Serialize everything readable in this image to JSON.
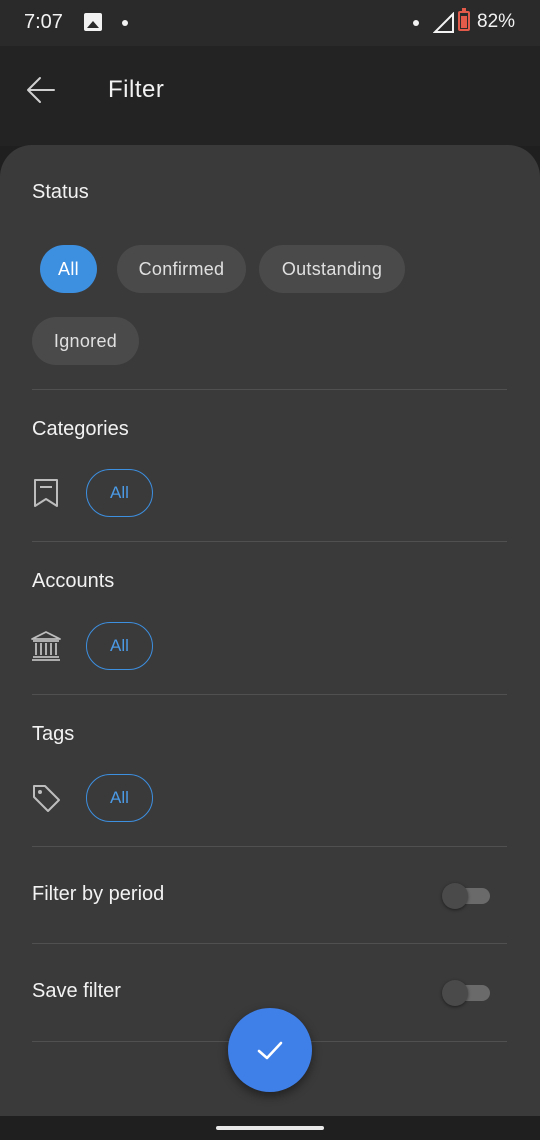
{
  "status_bar": {
    "time": "7:07",
    "battery_percent": "82%",
    "battery_level": 0.82,
    "icons": [
      "image-icon",
      "dot-icon",
      "dot-icon",
      "signal-icon",
      "battery-icon"
    ]
  },
  "app_bar": {
    "title": "Filter",
    "back_icon": "arrow-left-icon"
  },
  "status_section": {
    "title": "Status",
    "chips": [
      {
        "label": "All",
        "selected": true
      },
      {
        "label": "Confirmed",
        "selected": false
      },
      {
        "label": "Outstanding",
        "selected": false
      },
      {
        "label": "Ignored",
        "selected": false
      }
    ]
  },
  "categories_section": {
    "title": "Categories",
    "icon": "bookmark-icon",
    "value": "All"
  },
  "accounts_section": {
    "title": "Accounts",
    "icon": "bank-icon",
    "value": "All"
  },
  "tags_section": {
    "title": "Tags",
    "icon": "tag-icon",
    "value": "All"
  },
  "filter_by_period": {
    "label": "Filter by period",
    "enabled": false
  },
  "save_filter": {
    "label": "Save filter",
    "enabled": false
  },
  "fab": {
    "icon": "check-icon"
  },
  "colors": {
    "accent": "#3d8fe0",
    "fab": "#3f7fe8",
    "sheet_background": "#3a3a3a",
    "app_background": "#232323"
  }
}
